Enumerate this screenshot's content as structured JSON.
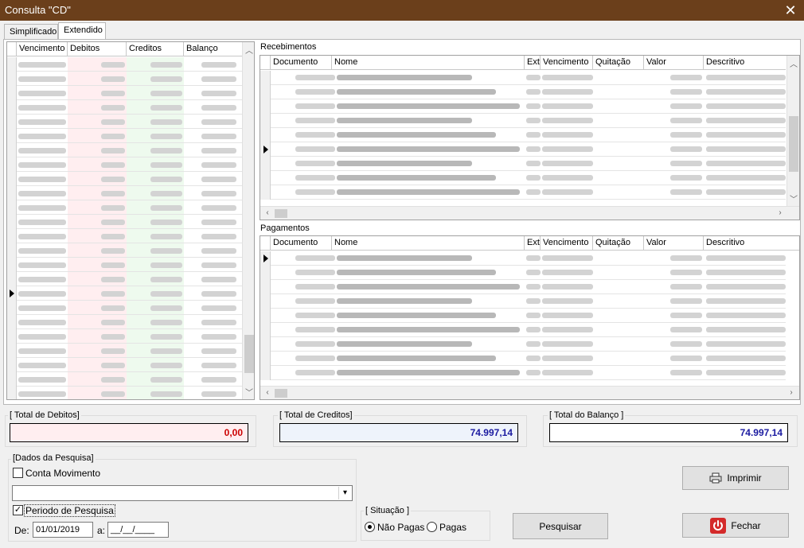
{
  "window": {
    "title": "Consulta \"CD\""
  },
  "tabs": [
    {
      "label": "Simplificado"
    },
    {
      "label": "Extendido"
    }
  ],
  "left_grid": {
    "columns": [
      "Vencimento",
      "Debitos",
      "Creditos",
      "Balanço"
    ]
  },
  "recebimentos": {
    "label": "Recebimentos",
    "columns": [
      "Documento",
      "Nome",
      "Ext",
      "Vencimento",
      "Quitação",
      "Valor",
      "Descritivo"
    ]
  },
  "pagamentos": {
    "label": "Pagamentos",
    "columns": [
      "Documento",
      "Nome",
      "Ext",
      "Vencimento",
      "Quitação",
      "Valor",
      "Descritivo"
    ]
  },
  "totals": {
    "debitos": {
      "label": "[ Total de Debitos]",
      "value": "0,00"
    },
    "creditos": {
      "label": "[ Total de Creditos]",
      "value": "74.997,14"
    },
    "balanco": {
      "label": "[ Total do Balanço ]",
      "value": "74.997,14"
    }
  },
  "search": {
    "group_label": "[Dados da Pesquisa]",
    "conta_movimento": "Conta Movimento",
    "periodo": "Periodo de Pesquisa",
    "de_label": "De:",
    "de_value": "01/01/2019",
    "a_label": "a:",
    "a_value": "__/__/____"
  },
  "situacao": {
    "label": "[ Situação ]",
    "nao_pagas": "Não Pagas",
    "pagas": "Pagas"
  },
  "buttons": {
    "pesquisar": "Pesquisar",
    "imprimir": "Imprimir",
    "fechar": "Fechar"
  },
  "colors": {
    "titlebar": "#6b3f1b",
    "debit_value": "#cc0000",
    "credit_value": "#1a1aa0",
    "debit_bg": "#ffeef0",
    "credit_bg": "#eef3fb"
  }
}
